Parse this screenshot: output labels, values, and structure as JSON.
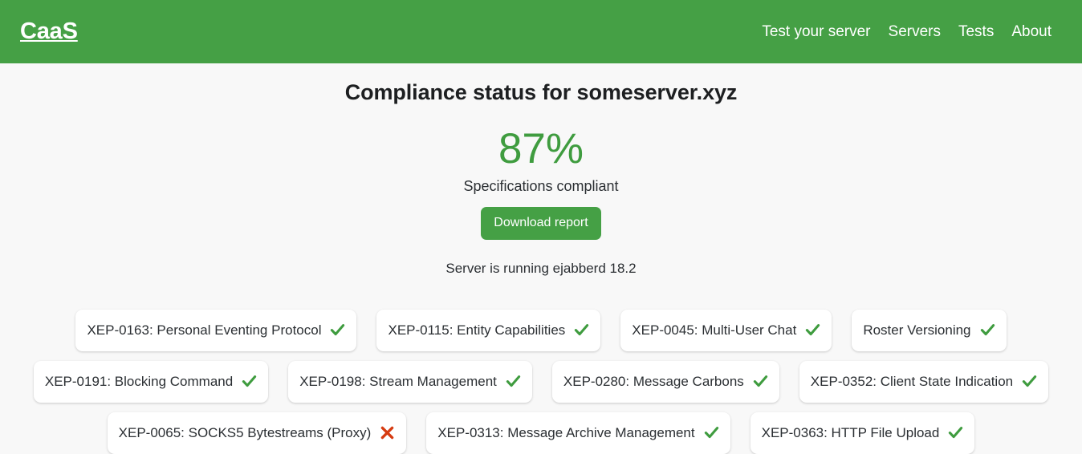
{
  "header": {
    "brand": "CaaS",
    "nav": [
      {
        "label": "Test your server",
        "name": "nav-link-test-your-server"
      },
      {
        "label": "Servers",
        "name": "nav-link-servers"
      },
      {
        "label": "Tests",
        "name": "nav-link-tests"
      },
      {
        "label": "About",
        "name": "nav-link-about"
      }
    ],
    "background_color": "#45a045",
    "text_color": "#ffffff"
  },
  "main": {
    "title": "Compliance status for someserver.xyz",
    "score": "87%",
    "score_caption": "Specifications compliant",
    "download_label": "Download report",
    "server_info": "Server is running ejabberd 18.2",
    "score_color": "#3f9c3f",
    "button_color": "#45a045",
    "pass_color": "#3f9c3f",
    "fail_color": "#d63b11"
  },
  "badges": {
    "rows": [
      [
        {
          "label": "XEP-0163: Personal Eventing Protocol",
          "status": "pass",
          "icon": "check-icon"
        },
        {
          "label": "XEP-0115: Entity Capabilities",
          "status": "pass",
          "icon": "check-icon"
        },
        {
          "label": "XEP-0045: Multi-User Chat",
          "status": "pass",
          "icon": "check-icon"
        },
        {
          "label": "Roster Versioning",
          "status": "pass",
          "icon": "check-icon"
        }
      ],
      [
        {
          "label": "XEP-0191: Blocking Command",
          "status": "pass",
          "icon": "check-icon"
        },
        {
          "label": "XEP-0198: Stream Management",
          "status": "pass",
          "icon": "check-icon"
        },
        {
          "label": "XEP-0280: Message Carbons",
          "status": "pass",
          "icon": "check-icon"
        },
        {
          "label": "XEP-0352: Client State Indication",
          "status": "pass",
          "icon": "check-icon"
        }
      ],
      [
        {
          "label": "XEP-0065: SOCKS5 Bytestreams (Proxy)",
          "status": "fail",
          "icon": "cross-icon"
        },
        {
          "label": "XEP-0313: Message Archive Management",
          "status": "pass",
          "icon": "check-icon"
        },
        {
          "label": "XEP-0363: HTTP File Upload",
          "status": "pass",
          "icon": "check-icon"
        }
      ]
    ]
  }
}
